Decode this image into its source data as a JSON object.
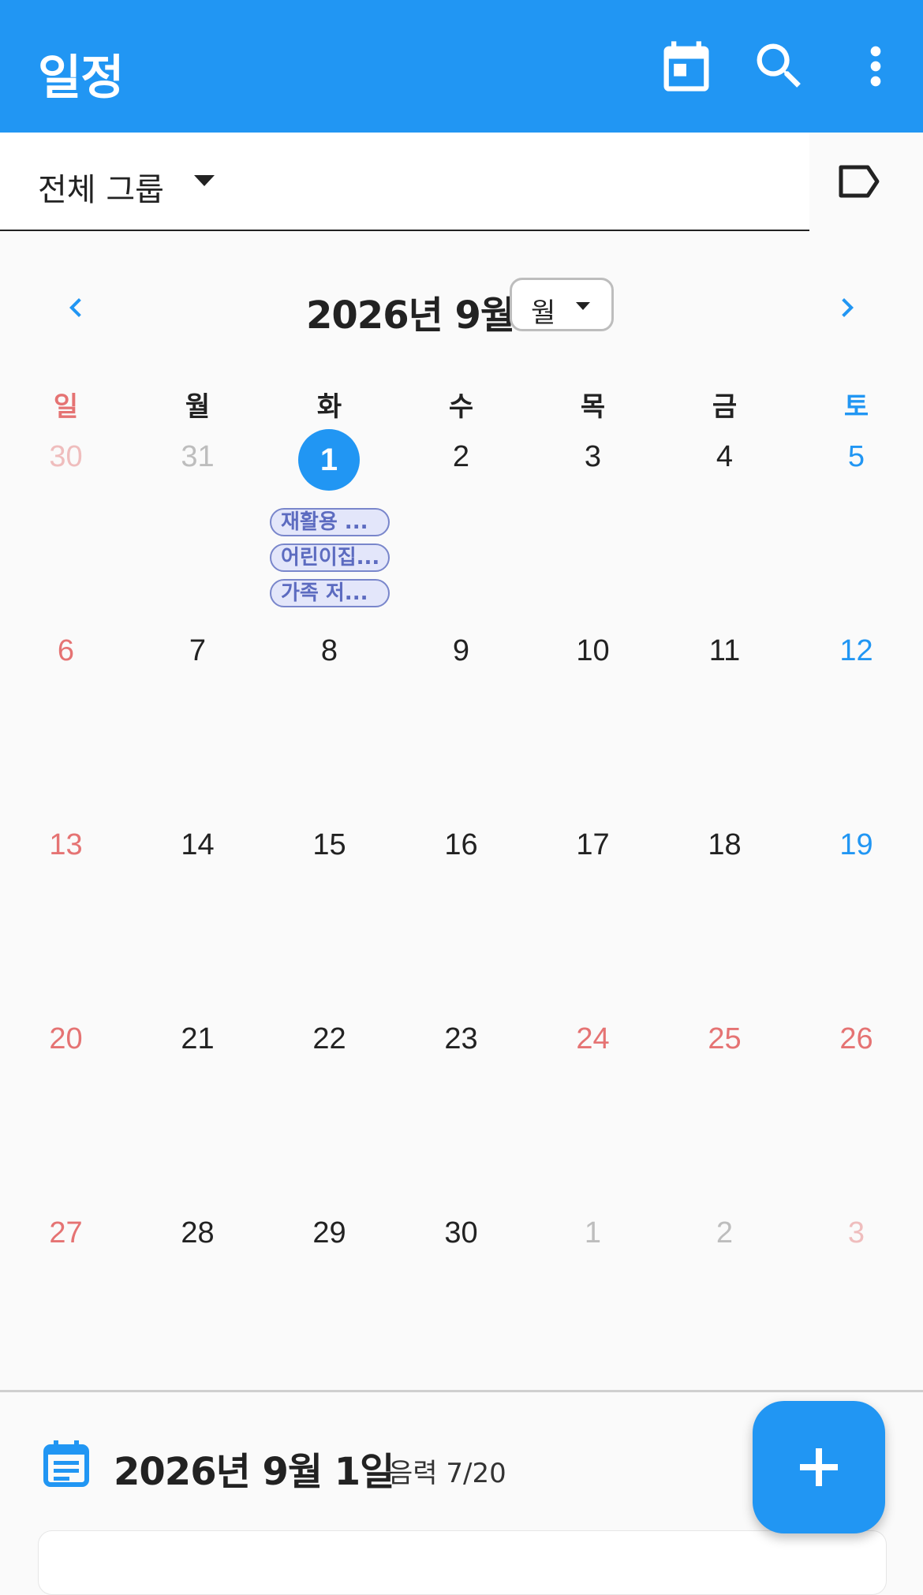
{
  "appbar": {
    "title": "일정",
    "icons": [
      "calendar-today-icon",
      "search-icon",
      "more-vert-icon"
    ]
  },
  "group_filter": {
    "label": "전체 그룹",
    "icon": "label-outline-icon"
  },
  "month_nav": {
    "title": "2026년 9월",
    "view_mode": "월"
  },
  "weekdays": [
    "일",
    "월",
    "화",
    "수",
    "목",
    "금",
    "토"
  ],
  "weeks": [
    [
      {
        "d": "30",
        "s": "muted-red"
      },
      {
        "d": "31",
        "s": "muted"
      },
      {
        "d": "1",
        "s": "today"
      },
      {
        "d": "2",
        "s": ""
      },
      {
        "d": "3",
        "s": ""
      },
      {
        "d": "4",
        "s": ""
      },
      {
        "d": "5",
        "s": "blue"
      }
    ],
    [
      {
        "d": "6",
        "s": "red"
      },
      {
        "d": "7",
        "s": ""
      },
      {
        "d": "8",
        "s": ""
      },
      {
        "d": "9",
        "s": ""
      },
      {
        "d": "10",
        "s": ""
      },
      {
        "d": "11",
        "s": ""
      },
      {
        "d": "12",
        "s": "blue"
      }
    ],
    [
      {
        "d": "13",
        "s": "red"
      },
      {
        "d": "14",
        "s": ""
      },
      {
        "d": "15",
        "s": ""
      },
      {
        "d": "16",
        "s": ""
      },
      {
        "d": "17",
        "s": ""
      },
      {
        "d": "18",
        "s": ""
      },
      {
        "d": "19",
        "s": "blue"
      }
    ],
    [
      {
        "d": "20",
        "s": "red"
      },
      {
        "d": "21",
        "s": ""
      },
      {
        "d": "22",
        "s": ""
      },
      {
        "d": "23",
        "s": ""
      },
      {
        "d": "24",
        "s": "red"
      },
      {
        "d": "25",
        "s": "red"
      },
      {
        "d": "26",
        "s": "red"
      }
    ],
    [
      {
        "d": "27",
        "s": "red"
      },
      {
        "d": "28",
        "s": ""
      },
      {
        "d": "29",
        "s": ""
      },
      {
        "d": "30",
        "s": ""
      },
      {
        "d": "1",
        "s": "muted"
      },
      {
        "d": "2",
        "s": "muted"
      },
      {
        "d": "3",
        "s": "muted-red"
      }
    ]
  ],
  "events_on_selected": [
    "재활용 ...",
    "어린이집...",
    "가족 저..."
  ],
  "selected_detail": {
    "date": "2026년 9월 1일",
    "lunar": "음력 7/20"
  },
  "colors": {
    "primary": "#2196f3",
    "sunday": "#e57373",
    "saturday": "#2196f3",
    "event_chip": "#7986cb"
  }
}
